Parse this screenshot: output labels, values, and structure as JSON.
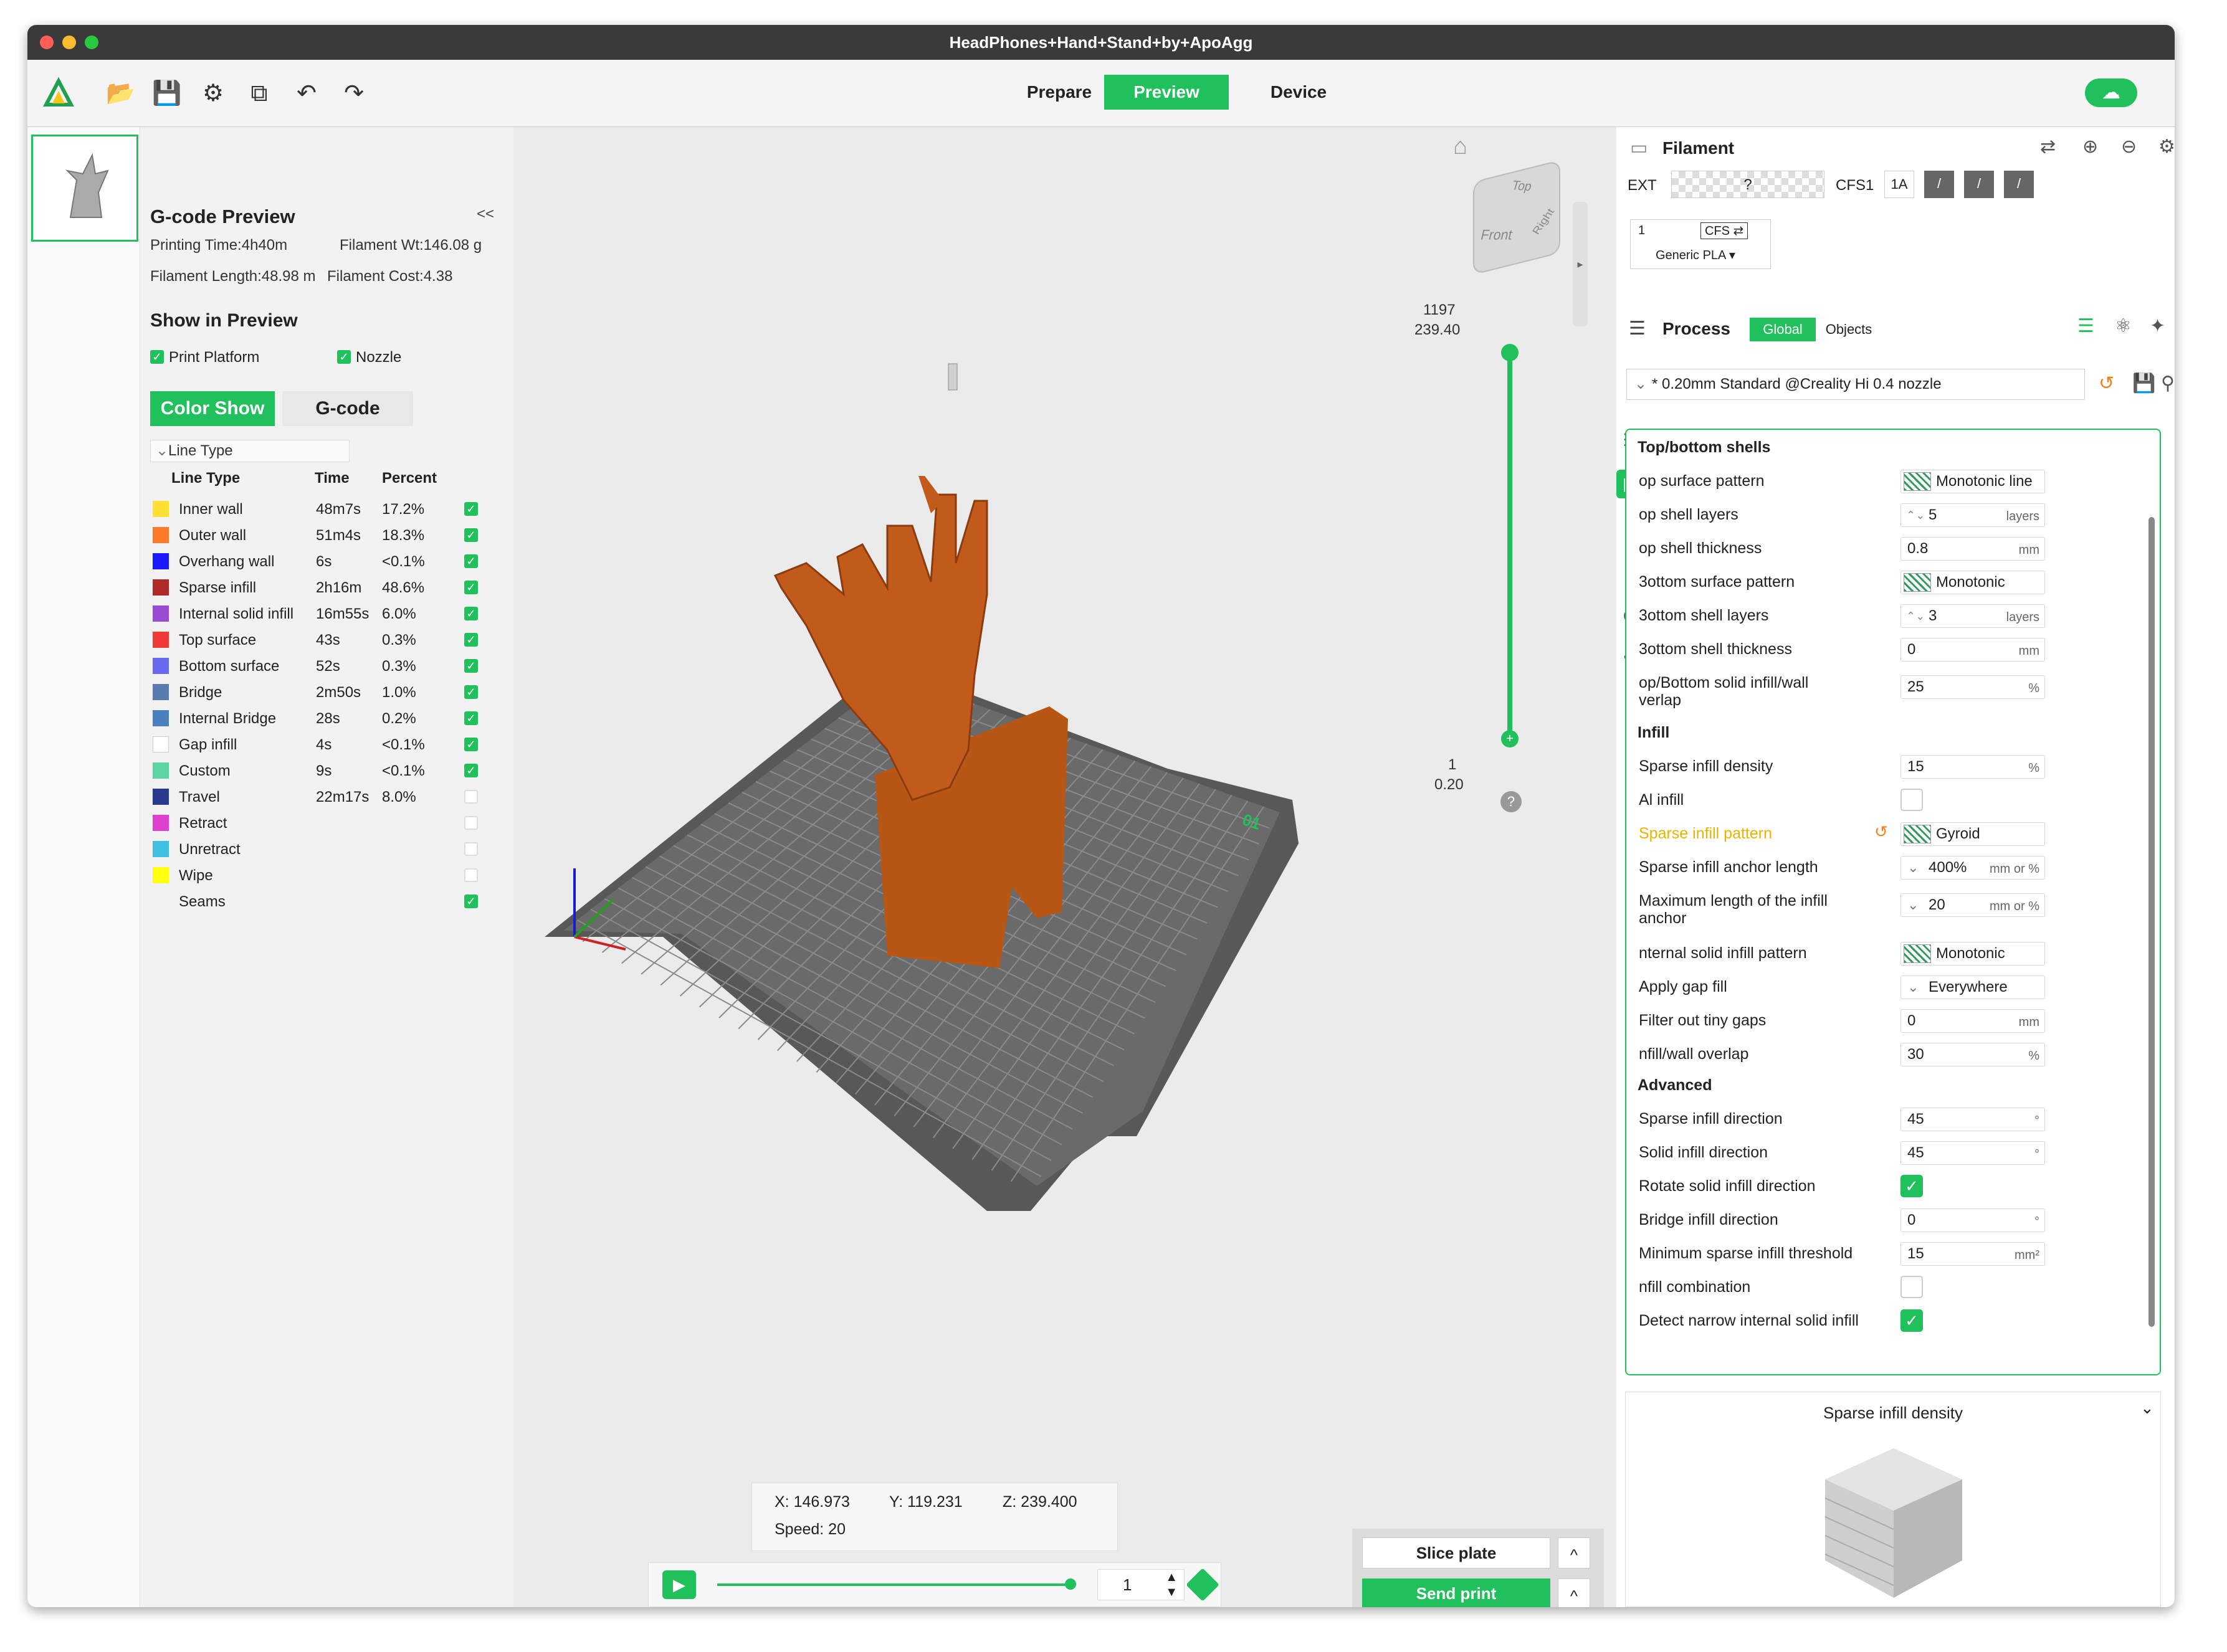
{
  "window": {
    "title": "HeadPhones+Hand+Stand+by+ApoAgg"
  },
  "toolbar": {
    "tabs": [
      {
        "label": "Prepare"
      },
      {
        "label": "Preview"
      },
      {
        "label": "Device"
      }
    ],
    "icons": [
      "logo-icon",
      "folder-open-icon",
      "save-icon",
      "gear-icon",
      "copy-icon",
      "undo-icon",
      "redo-icon"
    ]
  },
  "thumbs": {
    "number": "1",
    "collapse": "»"
  },
  "gcode": {
    "title": "G-code Preview",
    "collapse": "<<",
    "printing_time": "Printing Time:4h40m",
    "filament_wt": "Filament Wt:146.08 g",
    "filament_length": "Filament Length:48.98 m",
    "filament_cost": "Filament Cost:4.38",
    "show_title": "Show in Preview",
    "print_platform": "Print Platform",
    "nozzle": "Nozzle",
    "tab_color": "Color Show",
    "tab_gcode": "G-code",
    "line_type_dropdown": "Line Type",
    "headers": {
      "type": "Line Type",
      "time": "Time",
      "percent": "Percent"
    },
    "rows": [
      {
        "name": "Inner wall",
        "time": "48m7s",
        "percent": "17.2%",
        "color": "#ffe033",
        "checked": true
      },
      {
        "name": "Outer wall",
        "time": "51m4s",
        "percent": "18.3%",
        "color": "#ff7a2a",
        "checked": true
      },
      {
        "name": "Overhang wall",
        "time": "6s",
        "percent": "<0.1%",
        "color": "#1a1aff",
        "checked": true
      },
      {
        "name": "Sparse infill",
        "time": "2h16m",
        "percent": "48.6%",
        "color": "#b02a2a",
        "checked": true
      },
      {
        "name": "Internal solid infill",
        "time": "16m55s",
        "percent": "6.0%",
        "color": "#9b4bd1",
        "checked": true
      },
      {
        "name": "Top surface",
        "time": "43s",
        "percent": "0.3%",
        "color": "#f03a3a",
        "checked": true
      },
      {
        "name": "Bottom surface",
        "time": "52s",
        "percent": "0.3%",
        "color": "#6a6af0",
        "checked": true
      },
      {
        "name": "Bridge",
        "time": "2m50s",
        "percent": "1.0%",
        "color": "#5a7ab0",
        "checked": true
      },
      {
        "name": "Internal Bridge",
        "time": "28s",
        "percent": "0.2%",
        "color": "#4a80c0",
        "checked": true
      },
      {
        "name": "Gap infill",
        "time": "4s",
        "percent": "<0.1%",
        "color": "#ffffff",
        "checked": true
      },
      {
        "name": "Custom",
        "time": "9s",
        "percent": "<0.1%",
        "color": "#5ad4a0",
        "checked": true
      },
      {
        "name": "Travel",
        "time": "22m17s",
        "percent": "8.0%",
        "color": "#2a3a90",
        "checked": false
      },
      {
        "name": "Retract",
        "time": "",
        "percent": "",
        "color": "#e040d0",
        "checked": false
      },
      {
        "name": "Unretract",
        "time": "",
        "percent": "",
        "color": "#40c0e0",
        "checked": false
      },
      {
        "name": "Wipe",
        "time": "",
        "percent": "",
        "color": "#ffff10",
        "checked": false
      },
      {
        "name": "Seams",
        "time": "",
        "percent": "",
        "color": "",
        "checked": true
      }
    ]
  },
  "viewport": {
    "cube": {
      "top": "Top",
      "front": "Front",
      "right": "Right"
    },
    "layer_top": "1197",
    "layer_top_z": "239.40",
    "layer_bottom": "1",
    "layer_bottom_z": "0.20",
    "help": "?",
    "plate_num": "01",
    "coords": {
      "x": "X: 146.973",
      "y": "Y: 119.231",
      "z": "Z: 239.400",
      "speed": "Speed: 20"
    },
    "playback_value": "1",
    "progress": 1.0
  },
  "slice": {
    "slice_label": "Slice plate",
    "send_label": "Send print",
    "caret": "^"
  },
  "filament": {
    "title": "Filament",
    "ext": "EXT",
    "ext_value": "?",
    "cfs1": "CFS1",
    "slot1a": "1A",
    "slash": "/",
    "slot_num": "1",
    "cfs_badge": "CFS ⇄",
    "generic": "Generic PLA ▾"
  },
  "process": {
    "title": "Process",
    "global": "Global",
    "objects": "Objects",
    "preset": "* 0.20mm Standard @Creality Hi 0.4 nozzle"
  },
  "settings": {
    "sections": [
      {
        "title": "Top/bottom shells",
        "items": [
          {
            "label": "op surface pattern",
            "type": "pattern",
            "value": "Monotonic line"
          },
          {
            "label": "op shell layers",
            "type": "spin",
            "value": "5",
            "unit": "layers"
          },
          {
            "label": "op shell thickness",
            "type": "num",
            "value": "0.8",
            "unit": "mm"
          },
          {
            "label": "3ottom surface pattern",
            "type": "pattern",
            "value": "Monotonic"
          },
          {
            "label": "3ottom shell layers",
            "type": "spin",
            "value": "3",
            "unit": "layers"
          },
          {
            "label": "3ottom shell thickness",
            "type": "num",
            "value": "0",
            "unit": "mm"
          },
          {
            "label": "op/Bottom solid infill/wall",
            "label2": "verlap",
            "type": "num",
            "value": "25",
            "unit": "%"
          }
        ]
      },
      {
        "title": "Infill",
        "items": [
          {
            "label": "Sparse infill density",
            "type": "num",
            "value": "15",
            "unit": "%"
          },
          {
            "label": "Al infill",
            "type": "check",
            "checked": false
          },
          {
            "label": "Sparse infill pattern",
            "type": "pattern",
            "value": "Gyroid",
            "modified": true
          },
          {
            "label": "Sparse infill anchor length",
            "type": "combo",
            "value": "400%",
            "unit": "mm or %"
          },
          {
            "label": "Maximum length of the infill",
            "label2": "anchor",
            "type": "combo",
            "value": "20",
            "unit": "mm or %"
          },
          {
            "label": "nternal solid infill pattern",
            "type": "pattern",
            "value": "Monotonic"
          },
          {
            "label": "Apply gap fill",
            "type": "combo",
            "value": "Everywhere",
            "unit": ""
          },
          {
            "label": "Filter out tiny gaps",
            "type": "num",
            "value": "0",
            "unit": "mm"
          },
          {
            "label": "nfill/wall overlap",
            "type": "num",
            "value": "30",
            "unit": "%"
          }
        ]
      },
      {
        "title": "Advanced",
        "items": [
          {
            "label": "Sparse infill direction",
            "type": "num",
            "value": "45",
            "unit": "°"
          },
          {
            "label": "Solid infill direction",
            "type": "num",
            "value": "45",
            "unit": "°"
          },
          {
            "label": "Rotate solid infill direction",
            "type": "check",
            "checked": true
          },
          {
            "label": "Bridge infill direction",
            "type": "num",
            "value": "0",
            "unit": "°"
          },
          {
            "label": "Minimum sparse infill threshold",
            "type": "num",
            "value": "15",
            "unit": "mm²"
          },
          {
            "label": "nfill combination",
            "type": "check",
            "checked": false
          },
          {
            "label": "Detect narrow internal solid infill",
            "type": "check",
            "checked": true
          }
        ]
      }
    ]
  },
  "help_panel": {
    "title": "Sparse infill density",
    "caret": "⌄"
  },
  "colors": {
    "accent": "#20c05c",
    "model": "#c25a1c",
    "bed": "#5e5e5e",
    "modified": "#e8b400"
  }
}
